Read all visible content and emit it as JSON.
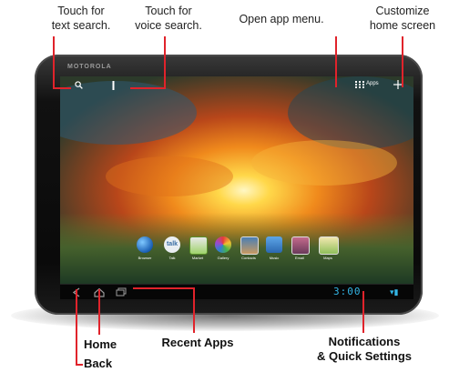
{
  "callouts": {
    "text_search": [
      "Touch for",
      "text search."
    ],
    "voice_search": [
      "Touch for",
      "voice search."
    ],
    "app_menu": "Open app menu.",
    "customize": [
      "Customize",
      "home screen"
    ],
    "home": "Home",
    "back": "Back",
    "recent_apps": "Recent Apps",
    "notifications": [
      "Notifications",
      "& Quick Settings"
    ]
  },
  "device": {
    "brand": "MOTOROLA",
    "apps_label": "Apps",
    "clock": "3:00"
  },
  "dock_apps": [
    "Browser",
    "Talk",
    "Market",
    "Gallery",
    "Contacts",
    "Music",
    "Email",
    "Maps"
  ],
  "colors": {
    "callout_line": "#e0232b",
    "status_accent": "#33b5e5"
  },
  "icons": {
    "search": "search-icon",
    "voice": "mic-icon",
    "apps": "apps-grid-icon",
    "customize": "plus-icon",
    "back": "back-arrow-icon",
    "home": "home-icon",
    "recent": "recent-apps-icon"
  }
}
